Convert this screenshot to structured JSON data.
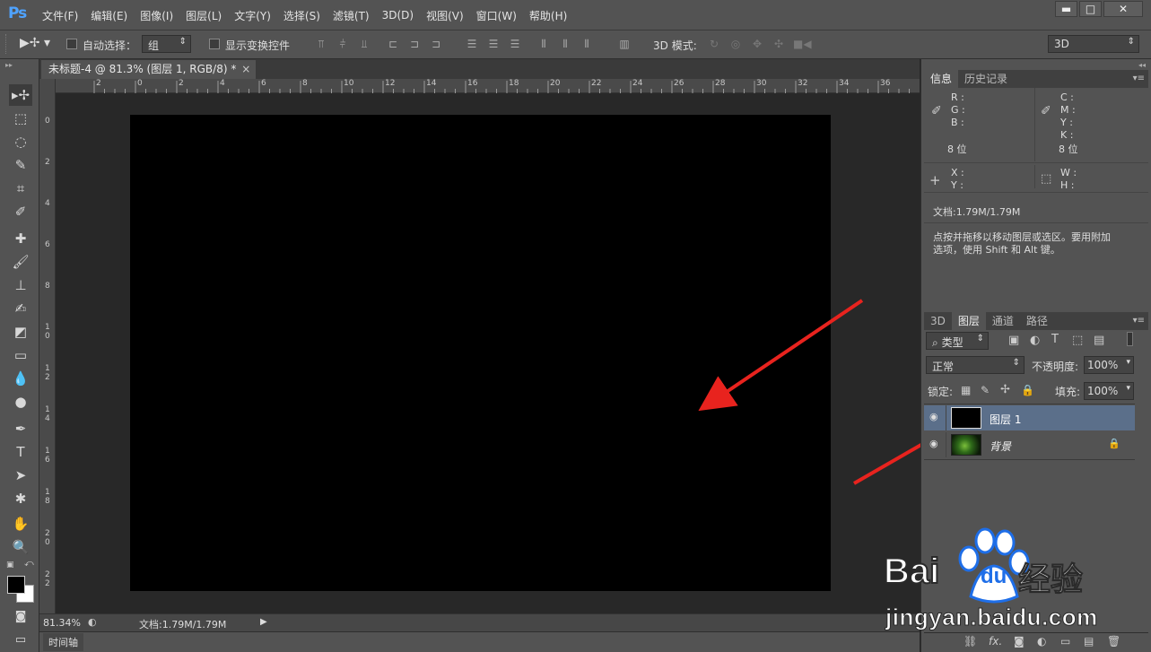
{
  "app": {
    "logo": "Ps"
  },
  "menu": [
    "文件(F)",
    "编辑(E)",
    "图像(I)",
    "图层(L)",
    "文字(Y)",
    "选择(S)",
    "滤镜(T)",
    "3D(D)",
    "视图(V)",
    "窗口(W)",
    "帮助(H)"
  ],
  "window_controls": {
    "minimize": "▬",
    "maximize": "□",
    "close": "✕"
  },
  "options": {
    "auto_select_label": "自动选择：",
    "auto_select_value": "组",
    "show_transform_label": "显示变换控件",
    "mode_3d_label": "3D 模式:",
    "workspace_value": "3D"
  },
  "document": {
    "tab_title": "未标题-4 @ 81.3% (图层 1, RGB/8) *",
    "close": "×",
    "ruler_top": [
      "2",
      "0",
      "2",
      "4",
      "6",
      "8",
      "10",
      "12",
      "14",
      "16",
      "18",
      "20",
      "22",
      "24",
      "26",
      "28",
      "30",
      "32",
      "34",
      "36"
    ],
    "ruler_left": [
      "0",
      "2",
      "4",
      "6",
      "8",
      "1\n0",
      "1\n2",
      "1\n4",
      "1\n6",
      "1\n8",
      "2\n0",
      "2\n2"
    ]
  },
  "status": {
    "zoom": "81.34%",
    "doc_size": "文档:1.79M/1.79M"
  },
  "timeline": {
    "label": "时间轴"
  },
  "info_panel": {
    "tabs": [
      "信息",
      "历史记录"
    ],
    "rgb": [
      "R :",
      "G :",
      "B :"
    ],
    "cmyk": [
      "C :",
      "M :",
      "Y :",
      "K :"
    ],
    "bits_left": "8 位",
    "bits_right": "8 位",
    "xy": [
      "X :",
      "Y :"
    ],
    "wh": [
      "W :",
      "H :"
    ],
    "doc": "文档:1.79M/1.79M",
    "hint_line1": "点按并拖移以移动图层或选区。要用附加",
    "hint_line2": "选项，使用 Shift 和 Alt 键。"
  },
  "layers_panel": {
    "tabs": [
      "3D",
      "图层",
      "通道",
      "路径"
    ],
    "filter_value": "类型",
    "blend_mode": "正常",
    "opacity_label": "不透明度:",
    "opacity_value": "100%",
    "lock_label": "锁定:",
    "fill_label": "填充:",
    "fill_value": "100%",
    "layers": [
      {
        "name": "图层 1",
        "selected": true
      },
      {
        "name": "背景",
        "selected": false
      }
    ]
  },
  "watermark": {
    "brand_bai": "Bai",
    "brand_du": "du",
    "brand_cn": "经验",
    "url": "jingyan.baidu.com"
  },
  "colors": {
    "accent_blue": "#4fa3ff",
    "selected_layer": "#5b6f8a",
    "annotation_red": "#e8231e",
    "canvas": "#000000"
  }
}
